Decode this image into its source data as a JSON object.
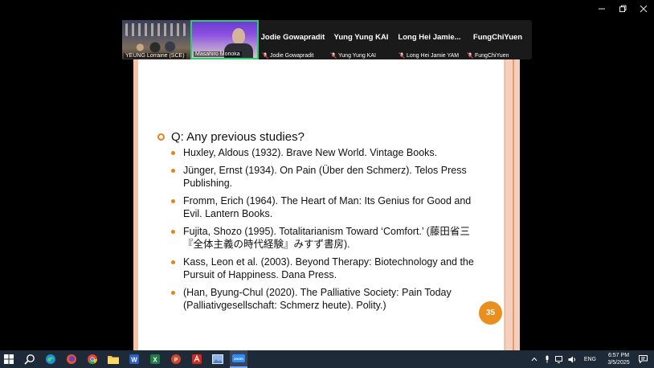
{
  "window": {
    "controls": {
      "minimize_icon": "minimize-icon",
      "restore_icon": "restore-icon",
      "close_icon": "close-icon"
    }
  },
  "participants": [
    {
      "kind": "video",
      "label": "YEUNG Lorraine (SCE)"
    },
    {
      "kind": "video",
      "label": "Masahiro Morioka",
      "speaking": true
    },
    {
      "kind": "name",
      "name": "Jodie Gowapradit",
      "label": "Jodie Gowapradit",
      "muted": true
    },
    {
      "kind": "name",
      "name": "Yung Yung KAI",
      "label": "Yung Yung KAI",
      "muted": true
    },
    {
      "kind": "name",
      "name": "Long Hei Jamie...",
      "label": "Long Hei Jamie YAM",
      "muted": true
    },
    {
      "kind": "name",
      "name": "FungChiYuen",
      "label": "FungChiYuen",
      "muted": true
    }
  ],
  "slide": {
    "question": "Q: Any previous studies?",
    "references": [
      "Huxley, Aldous (1932). Brave New World. Vintage Books.",
      "Jünger, Ernst (1934). On Pain (Über den Schmerz). Telos Press Publishing.",
      "Fromm, Erich (1964). The Heart of Man: Its Genius for Good and Evil. Lantern Books.",
      "Fujita, Shozo (1995). Totalitarianism Toward ‘Comfort.’ (藤田省三『全体主義の時代経験』みすず書房).",
      "Kass, Leon et al. (2003). Beyond Therapy: Biotechnology and the Pursuit of Happiness. Dana Press.",
      "(Han, Byung-Chul (2020). The Palliative Society: Pain Today (Palliativgesellschaft: Schmerz heute). Polity.)"
    ],
    "page_number": "35",
    "accent_color": "#e6821d"
  },
  "taskbar": {
    "apps": [
      "windows-start-icon",
      "search-icon",
      "edge-icon",
      "firefox-icon",
      "chrome-icon",
      "file-explorer-icon",
      "word-icon",
      "excel-icon",
      "powerpoint-icon",
      "acrobat-icon",
      "photos-icon",
      "zoom-icon"
    ],
    "language": "ENG",
    "time": "6:57 PM",
    "date": "3/5/2025"
  }
}
